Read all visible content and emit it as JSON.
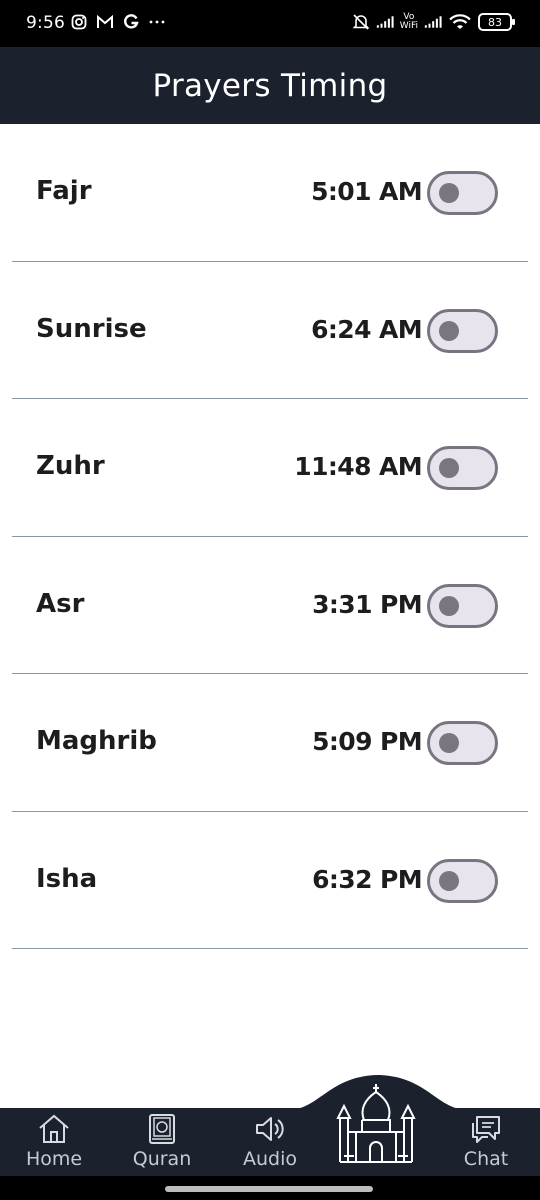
{
  "status_bar": {
    "time": "9:56",
    "left_icons": [
      "instagram-icon",
      "gmail-icon",
      "google-icon",
      "more-dots-icon"
    ],
    "vowifi_top": "Vo",
    "vowifi_bottom": "WiFi",
    "battery": "83"
  },
  "header": {
    "title": "Prayers Timing"
  },
  "prayers": [
    {
      "name": "Fajr",
      "time": "5:01 AM",
      "enabled": false
    },
    {
      "name": "Sunrise",
      "time": "6:24 AM",
      "enabled": false
    },
    {
      "name": "Zuhr",
      "time": "11:48 AM",
      "enabled": false
    },
    {
      "name": "Asr",
      "time": "3:31 PM",
      "enabled": false
    },
    {
      "name": "Maghrib",
      "time": "5:09 PM",
      "enabled": false
    },
    {
      "name": "Isha",
      "time": "6:32 PM",
      "enabled": false
    }
  ],
  "bottom_nav": {
    "items": [
      {
        "label": "Home",
        "icon": "home-icon"
      },
      {
        "label": "Quran",
        "icon": "quran-icon"
      },
      {
        "label": "Audio",
        "icon": "speaker-icon"
      },
      {
        "label": "",
        "icon": "mosque-icon"
      },
      {
        "label": "Chat",
        "icon": "chat-icon"
      }
    ]
  },
  "colors": {
    "header_bg": "#1b212d",
    "divider": "#8a98a8",
    "toggle_track": "#e8e4ee",
    "toggle_knob": "#79767f",
    "text": "#1d1d1f"
  }
}
